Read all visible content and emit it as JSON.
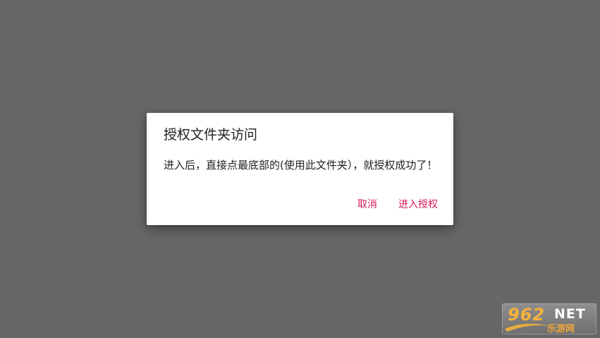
{
  "dialog": {
    "title": "授权文件夹访问",
    "message": "进入后，直接点最底部的(使用此文件夹），就授权成功了！",
    "cancel_label": "取消",
    "confirm_label": "进入授权"
  },
  "watermark": {
    "number": "962",
    "net": "NET",
    "tagline": "乐游网"
  },
  "colors": {
    "backdrop": "#676767",
    "dialog_bg": "#ffffff",
    "accent": "#d81b60",
    "text": "#212121"
  }
}
